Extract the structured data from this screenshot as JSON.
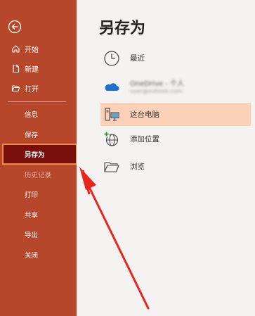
{
  "sidebar": {
    "back_icon": "back-arrow-circle-icon",
    "top_items": [
      {
        "label": "开始",
        "icon": "home-icon"
      },
      {
        "label": "新建",
        "icon": "new-document-icon"
      },
      {
        "label": "打开",
        "icon": "open-folder-icon"
      }
    ],
    "sub_items": [
      {
        "label": "信息"
      },
      {
        "label": "保存"
      },
      {
        "label": "另存为"
      },
      {
        "label": "历史记录"
      },
      {
        "label": "打印"
      },
      {
        "label": "共享"
      },
      {
        "label": "导出"
      },
      {
        "label": "关闭"
      }
    ]
  },
  "main": {
    "title": "另存为",
    "locations": [
      {
        "label": "最近",
        "icon": "clock-icon"
      },
      {
        "label": "OneDrive - 个人",
        "sub": "user@outlook.com",
        "icon": "onedrive-cloud-icon"
      },
      {
        "label": "这台电脑",
        "icon": "this-pc-icon"
      },
      {
        "label": "添加位置",
        "icon": "add-globe-icon"
      },
      {
        "label": "浏览",
        "icon": "folder-icon"
      }
    ]
  },
  "colors": {
    "sidebar_bg": "#b7472a",
    "selected_bg": "#780f0a",
    "selected_outline": "#f08a3c",
    "highlight_row": "#fbd1b8",
    "annotation_arrow": "#e8261c"
  }
}
